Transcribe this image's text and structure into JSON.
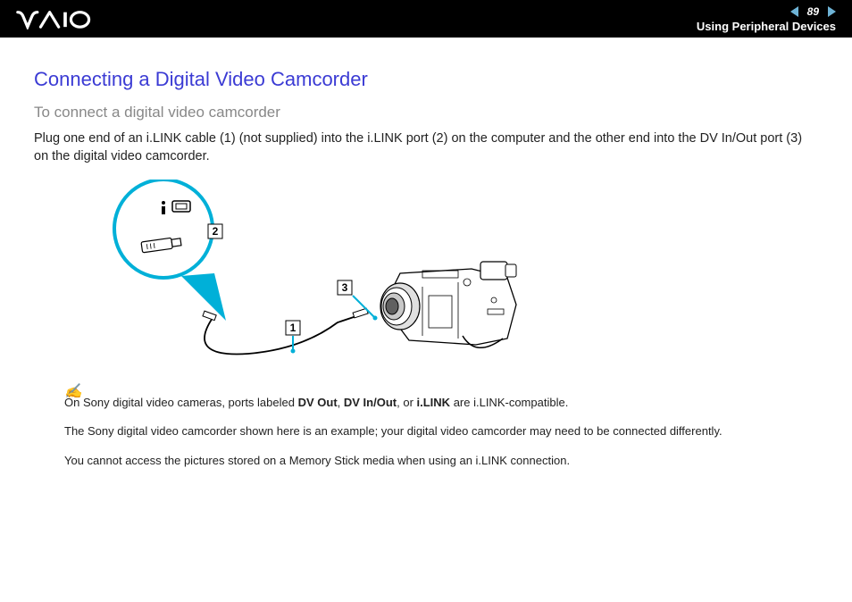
{
  "header": {
    "logo_text": "VAIO",
    "page_number": "89",
    "section": "Using Peripheral Devices"
  },
  "content": {
    "heading": "Connecting a Digital Video Camcorder",
    "subheading": "To connect a digital video camcorder",
    "body": "Plug one end of an i.LINK cable (1) (not supplied) into the i.LINK port (2) on the computer and the other end into the DV In/Out port (3) on the digital video camcorder."
  },
  "diagram": {
    "callouts": [
      "1",
      "2",
      "3"
    ]
  },
  "notes": {
    "line1_prefix": "On Sony digital video cameras, ports labeled ",
    "line1_b1": "DV Out",
    "line1_sep": ", ",
    "line1_b2": "DV In/Out",
    "line1_sep2": ", or ",
    "line1_b3": "i.LINK",
    "line1_suffix": " are i.LINK-compatible.",
    "line2": "The Sony digital video camcorder shown here is an example; your digital video camcorder may need to be connected differently.",
    "line3": "You cannot access the pictures stored on a Memory Stick media when using an i.LINK connection."
  }
}
